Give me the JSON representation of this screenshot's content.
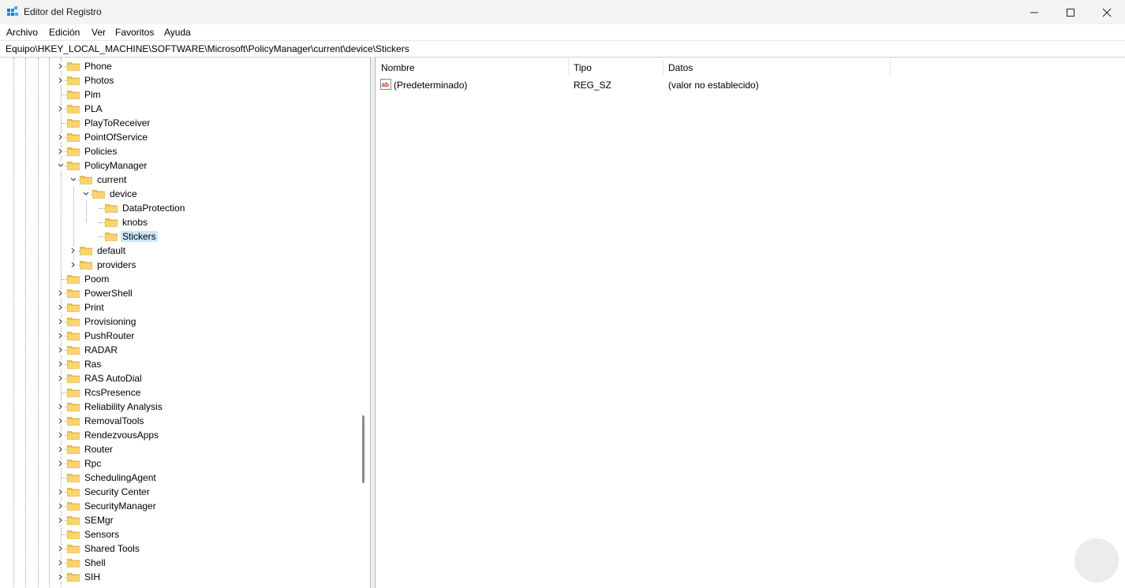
{
  "window": {
    "title": "Editor del Registro",
    "icon": "registry-editor-icon",
    "controls": [
      "minimize-icon",
      "maximize-icon",
      "close-icon"
    ]
  },
  "menu": {
    "items": [
      "Archivo",
      "Edición",
      "Ver",
      "Favoritos",
      "Ayuda"
    ]
  },
  "address": {
    "path": "Equipo\\HKEY_LOCAL_MACHINE\\SOFTWARE\\Microsoft\\PolicyManager\\current\\device\\Stickers"
  },
  "tree": {
    "items": [
      {
        "label": "Phone",
        "expander": "collapsed"
      },
      {
        "label": "Photos",
        "expander": "collapsed"
      },
      {
        "label": "Pim",
        "expander": "none"
      },
      {
        "label": "PLA",
        "expander": "collapsed"
      },
      {
        "label": "PlayToReceiver",
        "expander": "none"
      },
      {
        "label": "PointOfService",
        "expander": "collapsed"
      },
      {
        "label": "Policies",
        "expander": "collapsed"
      },
      {
        "label": "PolicyManager",
        "expander": "expanded"
      },
      {
        "label": "current",
        "expander": "expanded"
      },
      {
        "label": "device",
        "expander": "expanded"
      },
      {
        "label": "DataProtection",
        "expander": "none"
      },
      {
        "label": "knobs",
        "expander": "none"
      },
      {
        "label": "Stickers",
        "expander": "none",
        "selected": true
      },
      {
        "label": "default",
        "expander": "collapsed"
      },
      {
        "label": "providers",
        "expander": "collapsed"
      },
      {
        "label": "Poom",
        "expander": "none"
      },
      {
        "label": "PowerShell",
        "expander": "collapsed"
      },
      {
        "label": "Print",
        "expander": "collapsed"
      },
      {
        "label": "Provisioning",
        "expander": "collapsed"
      },
      {
        "label": "PushRouter",
        "expander": "collapsed"
      },
      {
        "label": "RADAR",
        "expander": "collapsed"
      },
      {
        "label": "Ras",
        "expander": "collapsed"
      },
      {
        "label": "RAS AutoDial",
        "expander": "collapsed"
      },
      {
        "label": "RcsPresence",
        "expander": "none"
      },
      {
        "label": "Reliability Analysis",
        "expander": "collapsed"
      },
      {
        "label": "RemovalTools",
        "expander": "collapsed"
      },
      {
        "label": "RendezvousApps",
        "expander": "collapsed"
      },
      {
        "label": "Router",
        "expander": "collapsed"
      },
      {
        "label": "Rpc",
        "expander": "collapsed"
      },
      {
        "label": "SchedulingAgent",
        "expander": "none"
      },
      {
        "label": "Security Center",
        "expander": "collapsed"
      },
      {
        "label": "SecurityManager",
        "expander": "collapsed"
      },
      {
        "label": "SEMgr",
        "expander": "collapsed"
      },
      {
        "label": "Sensors",
        "expander": "none"
      },
      {
        "label": "Shared Tools",
        "expander": "collapsed"
      },
      {
        "label": "Shell",
        "expander": "collapsed"
      },
      {
        "label": "SIH",
        "expander": "collapsed"
      }
    ]
  },
  "values": {
    "columns": [
      "Nombre",
      "Tipo",
      "Datos"
    ],
    "rows": [
      {
        "icon": "string-value-icon",
        "name": "(Predeterminado)",
        "type": "REG_SZ",
        "data": "(valor no establecido)"
      }
    ]
  },
  "colors": {
    "folder": "#f2c14e",
    "selection": "#cce8ff",
    "titlebar": "#f3f3f3",
    "accent": "#0067c0"
  }
}
